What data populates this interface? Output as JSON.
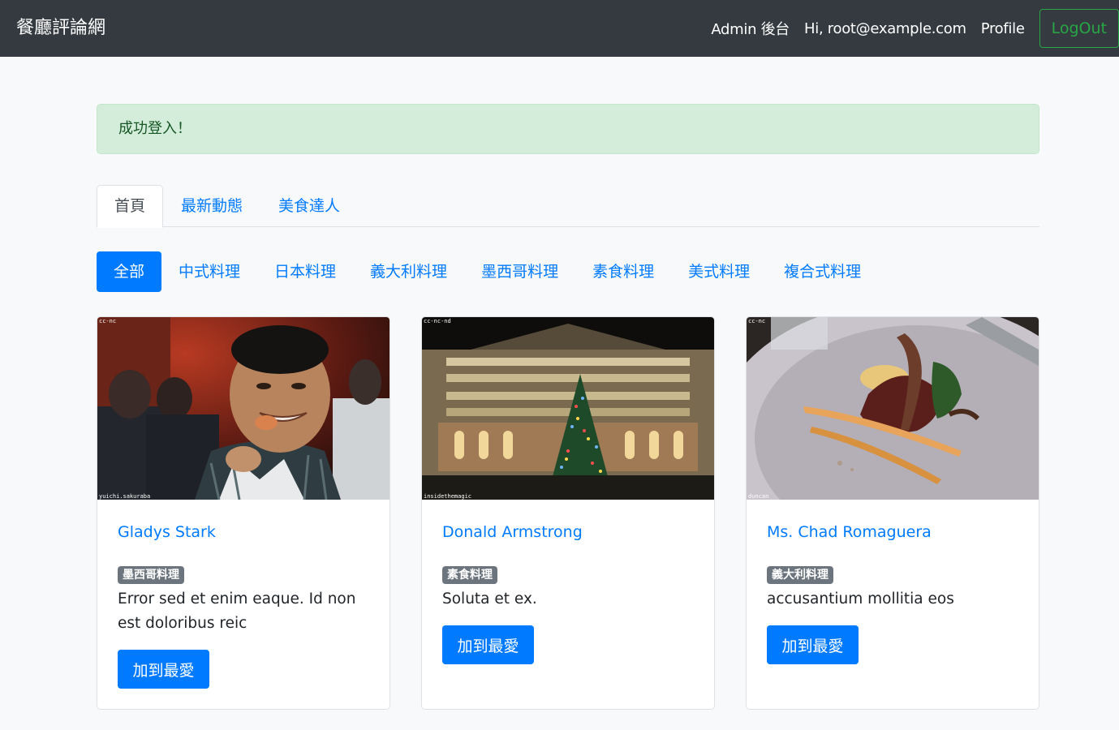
{
  "navbar": {
    "brand": "餐廳評論網",
    "admin_link": "Admin 後台",
    "greeting": "Hi, root@example.com",
    "profile_link": "Profile",
    "logout_button": "LogOut"
  },
  "alert": {
    "message": "成功登入！"
  },
  "tabs": [
    {
      "label": "首頁",
      "active": true
    },
    {
      "label": "最新動態",
      "active": false
    },
    {
      "label": "美食達人",
      "active": false
    }
  ],
  "categories": [
    {
      "label": "全部",
      "active": true
    },
    {
      "label": "中式料理",
      "active": false
    },
    {
      "label": "日本料理",
      "active": false
    },
    {
      "label": "義大利料理",
      "active": false
    },
    {
      "label": "墨西哥料理",
      "active": false
    },
    {
      "label": "素食料理",
      "active": false
    },
    {
      "label": "美式料理",
      "active": false
    },
    {
      "label": "複合式料理",
      "active": false
    }
  ],
  "restaurants": [
    {
      "name": "Gladys Stark",
      "category": "墨西哥料理",
      "description": "Error sed et enim eaque. Id non est doloribus reic",
      "button": "加到最愛",
      "image_credit_top": "cc-nc",
      "image_credit_bottom": "yuichi.sakuraba"
    },
    {
      "name": "Donald Armstrong",
      "category": "素食料理",
      "description": "Soluta et ex.",
      "button": "加到最愛",
      "image_credit_top": "cc-nc-nd",
      "image_credit_bottom": "insidethemagic"
    },
    {
      "name": "Ms. Chad Romaguera",
      "category": "義大利料理",
      "description": "accusantium mollitia eos",
      "button": "加到最愛",
      "image_credit_top": "cc-nc",
      "image_credit_bottom": "duncan"
    }
  ],
  "colors": {
    "navbar_bg": "#343a40",
    "primary": "#007bff",
    "success": "#28a745",
    "alert_bg": "#d4edda",
    "badge_bg": "#6c757d",
    "page_bg": "#f8f9fa"
  }
}
